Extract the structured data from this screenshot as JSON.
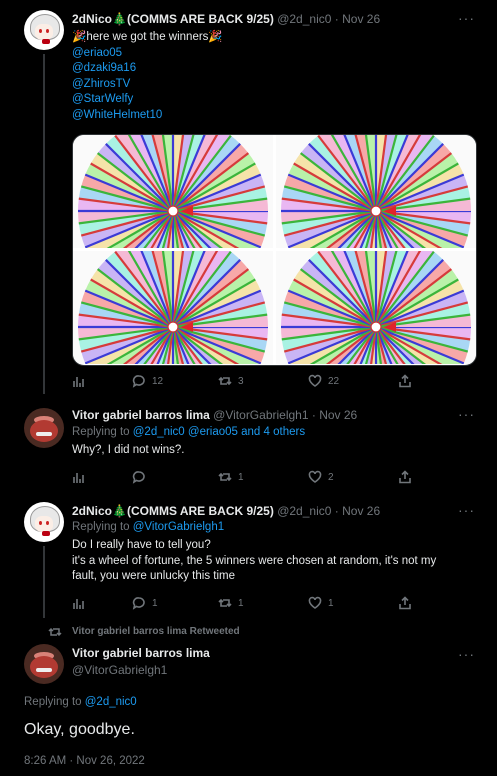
{
  "tweet1": {
    "display_name": "2dNico🎄(COMMS ARE BACK 9/25)",
    "handle": "@2d_nic0",
    "separator": "·",
    "date": "Nov 26",
    "text_line": "🎉here we got the winners🎉",
    "mentions": [
      "@eriao05",
      "@dzaki9a16",
      "@ZhirosTV",
      "@StarWelfy",
      "@WhiteHelmet10"
    ],
    "media_alt": "wheel of fortune results",
    "stats": {
      "replies": "12",
      "retweets": "3",
      "likes": "22"
    }
  },
  "tweet2": {
    "display_name": "Vitor gabriel barros lima",
    "handle": "@VitorGabrielgh1",
    "separator": "·",
    "date": "Nov 26",
    "replying_prefix": "Replying to",
    "replying_users": "@2d_nic0 @eriao05 and 4 others",
    "text": "Why?, I did not wins?.",
    "stats": {
      "replies": "",
      "retweets": "1",
      "likes": "2"
    }
  },
  "tweet3": {
    "display_name": "2dNico🎄(COMMS ARE BACK 9/25)",
    "handle": "@2d_nic0",
    "separator": "·",
    "date": "Nov 26",
    "replying_prefix": "Replying to",
    "replying_users": "@VitorGabrielgh1",
    "lines": [
      "Do I really have to tell you?",
      "it's a wheel of fortune, the 5 winners were chosen at random, it's not my",
      "fault, you were unlucky this time"
    ],
    "stats": {
      "replies": "1",
      "retweets": "1",
      "likes": "1"
    }
  },
  "main_tweet": {
    "retweet_notice": "Vitor gabriel barros lima Retweeted",
    "display_name": "Vitor gabriel barros lima",
    "handle": "@VitorGabrielgh1",
    "replying_prefix": "Replying to",
    "replying_users": "@2d_nic0",
    "text": "Okay, goodbye.",
    "timestamp": "8:26 AM · Nov 26, 2022"
  },
  "ui": {
    "more": "···"
  },
  "colors": {
    "background": "#000000",
    "text": "#e7e9ea",
    "muted": "#71767b",
    "link": "#1d9bf0"
  }
}
